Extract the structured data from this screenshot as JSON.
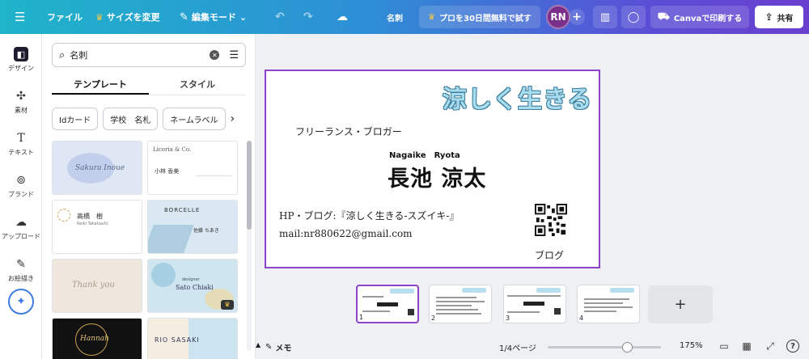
{
  "topbar": {
    "menu_icon": "hamburger-icon",
    "file_label": "ファイル",
    "resize_label": "サイズを変更",
    "edit_mode_label": "編集モード",
    "design_title": "名刺",
    "pro_trial_label": "プロを30日間無料で試す",
    "avatar_initials": "RN",
    "print_label": "Canvaで印刷する",
    "share_label": "共有"
  },
  "rail": {
    "items": [
      {
        "label": "デザイン",
        "icon": "design-icon"
      },
      {
        "label": "素材",
        "icon": "elements-icon"
      },
      {
        "label": "テキスト",
        "icon": "text-icon"
      },
      {
        "label": "ブランド",
        "icon": "brand-icon"
      },
      {
        "label": "アップロード",
        "icon": "upload-icon"
      },
      {
        "label": "お絵描き",
        "icon": "draw-icon"
      }
    ]
  },
  "panel": {
    "search_value": "名刺",
    "tabs": [
      "テンプレート",
      "スタイル"
    ],
    "chips": [
      "Idカード",
      "学校　名札",
      "ネームラベル"
    ],
    "thumbs": [
      {
        "text": "Sakura Inoue",
        "sub": "",
        "color": "#dfe7f4"
      },
      {
        "text": "Licoria & Co.",
        "sub": "小林 香美",
        "color": "#ffffff"
      },
      {
        "text": "高橋　樹",
        "sub": "Reiki Takahashi",
        "color": "#ffffff"
      },
      {
        "text": "BORCELLE",
        "sub": "佐藤 ちあき",
        "color": "#d9e8f2"
      },
      {
        "text": "Thank you",
        "sub": "",
        "color": "#efe6de"
      },
      {
        "text": "Sato Chiaki",
        "sub": "designer",
        "color": "#cfe6f0"
      },
      {
        "text": "Hannah",
        "sub": "",
        "color": "#111111"
      },
      {
        "text": "RIO SASAKI",
        "sub": "",
        "color": "#f5ede0"
      }
    ]
  },
  "card": {
    "logo": "涼しく生きる",
    "role": "フリーランス・ブロガー",
    "romaji": "Nagaike　Ryota",
    "name": "長池 涼太",
    "hp": "HP・ブログ:『涼しく生きる-スズイキ-』",
    "mail": "mail:nr880622@gmail.com",
    "blog": "ブログ"
  },
  "pages": {
    "thumbs": [
      {
        "num": "1"
      },
      {
        "num": "2"
      },
      {
        "num": "3"
      },
      {
        "num": "4"
      }
    ],
    "add_label": "+"
  },
  "bottombar": {
    "memo_label": "メモ",
    "page_count": "1/4ページ",
    "zoom": "175%",
    "zoom_fraction": 0.7
  }
}
